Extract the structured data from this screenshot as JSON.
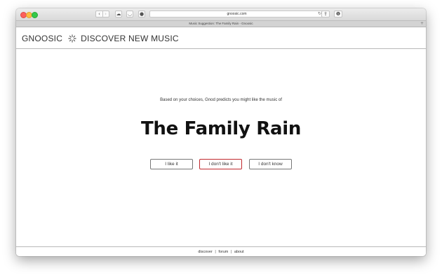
{
  "toolbar": {
    "back_icon": "chevron-left-icon",
    "forward_icon": "chevron-right-icon",
    "url": "gnoosic.com"
  },
  "tab": {
    "title": "Music Suggestion: The Family Rain - Gnoosic"
  },
  "header": {
    "brand": "GNOOSIC",
    "tagline": "DISCOVER NEW MUSIC"
  },
  "main": {
    "prompt": "Based on your choices, Gnod predicts you might like the music of",
    "artist": "The Family Rain",
    "buttons": {
      "like": "I like it",
      "dislike": "I don't like it",
      "unknown": "I don't know"
    }
  },
  "footer": {
    "links": [
      "discover",
      "forum",
      "about"
    ],
    "separator": "|"
  },
  "colors": {
    "dislike_border": "#c0282d",
    "text": "#333333"
  }
}
